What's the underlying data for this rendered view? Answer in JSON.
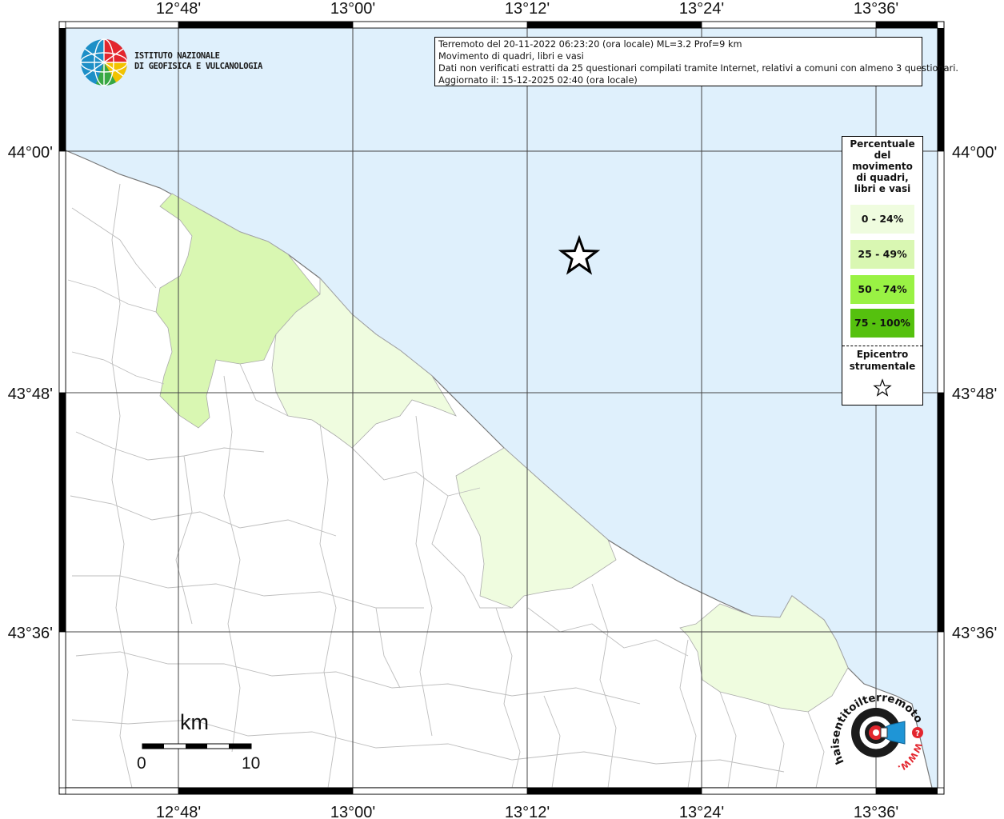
{
  "info": {
    "line1": "Terremoto del 20-11-2022 06:23:20 (ora locale) ML=3.2 Prof=9 km",
    "line2": "Movimento di quadri, libri e vasi",
    "line3": "Dati non verificati estratti da 25 questionari compilati tramite Internet, relativi a comuni con almeno 3 questionari.",
    "line4": "Aggiornato il: 15-12-2025 02:40 (ora locale)"
  },
  "logo": {
    "line1": "ISTITUTO NAZIONALE",
    "line2": "DI GEOFISICA E VULCANOLOGIA"
  },
  "axes": {
    "lon_ticks": [
      "12°48'",
      "13°00'",
      "13°12'",
      "13°24'",
      "13°36'"
    ],
    "lat_ticks": [
      "44°00'",
      "43°48'",
      "43°36'"
    ]
  },
  "legend": {
    "title_lines": [
      "Percentuale",
      "del",
      "movimento",
      "di quadri,",
      "libri e vasi"
    ],
    "classes": [
      {
        "label": "0 - 24%",
        "color": "#effcdf"
      },
      {
        "label": "25 - 49%",
        "color": "#d9f7b2"
      },
      {
        "label": "50 - 74%",
        "color": "#99f244"
      },
      {
        "label": "75 - 100%",
        "color": "#55c10e"
      }
    ],
    "epicenter_line1": "Epicentro",
    "epicenter_line2": "strumentale"
  },
  "scale": {
    "unit": "km",
    "start": "0",
    "end": "10"
  },
  "badge": {
    "text": "haisentitoilterremoto.it",
    "www": "WWW.",
    "question": "?"
  },
  "colors": {
    "sea": "#dff0fc",
    "land": "#ffffff",
    "coast": "#777777",
    "border": "#bdbdbd"
  }
}
